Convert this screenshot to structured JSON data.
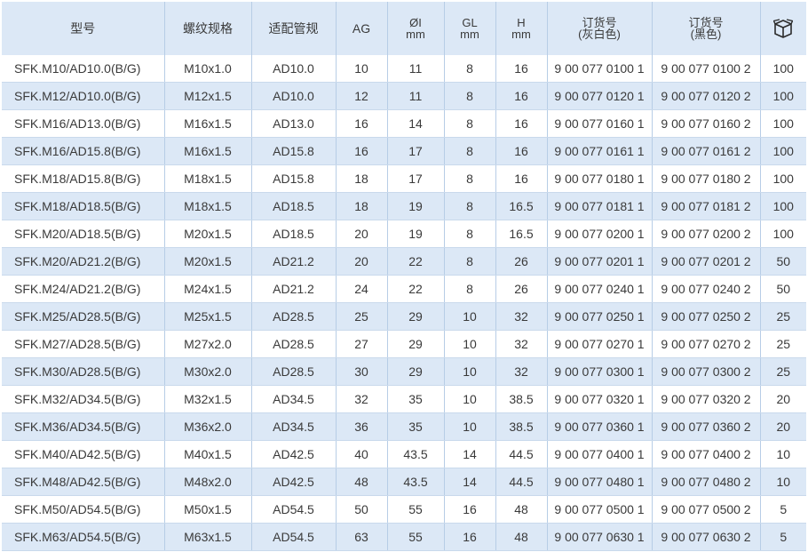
{
  "table": {
    "headers": {
      "model": "型号",
      "thread": "螺纹规格",
      "conduit": "适配管规",
      "ag": "AG",
      "id_top": "ØI",
      "id_unit": "mm",
      "gl_top": "GL",
      "gl_unit": "mm",
      "h_top": "H",
      "h_unit": "mm",
      "order_grey_top": "订货号",
      "order_grey_sub": "(灰白色)",
      "order_black_top": "订货号",
      "order_black_sub": "(黑色)",
      "package_icon": "box-icon"
    },
    "rows": [
      [
        "SFK.M10/AD10.0(B/G)",
        "M10x1.0",
        "AD10.0",
        "10",
        "11",
        "8",
        "16",
        "9 00 077 0100 1",
        "9 00 077 0100 2",
        "100"
      ],
      [
        "SFK.M12/AD10.0(B/G)",
        "M12x1.5",
        "AD10.0",
        "12",
        "11",
        "8",
        "16",
        "9 00 077 0120 1",
        "9 00 077 0120 2",
        "100"
      ],
      [
        "SFK.M16/AD13.0(B/G)",
        "M16x1.5",
        "AD13.0",
        "16",
        "14",
        "8",
        "16",
        "9 00 077 0160 1",
        "9 00 077 0160 2",
        "100"
      ],
      [
        "SFK.M16/AD15.8(B/G)",
        "M16x1.5",
        "AD15.8",
        "16",
        "17",
        "8",
        "16",
        "9 00 077 0161 1",
        "9 00 077 0161 2",
        "100"
      ],
      [
        "SFK.M18/AD15.8(B/G)",
        "M18x1.5",
        "AD15.8",
        "18",
        "17",
        "8",
        "16",
        "9 00 077 0180 1",
        "9 00 077 0180 2",
        "100"
      ],
      [
        "SFK.M18/AD18.5(B/G)",
        "M18x1.5",
        "AD18.5",
        "18",
        "19",
        "8",
        "16.5",
        "9 00 077 0181 1",
        "9 00 077 0181 2",
        "100"
      ],
      [
        "SFK.M20/AD18.5(B/G)",
        "M20x1.5",
        "AD18.5",
        "20",
        "19",
        "8",
        "16.5",
        "9 00 077 0200 1",
        "9 00 077 0200 2",
        "100"
      ],
      [
        "SFK.M20/AD21.2(B/G)",
        "M20x1.5",
        "AD21.2",
        "20",
        "22",
        "8",
        "26",
        "9 00 077 0201 1",
        "9 00 077 0201 2",
        "50"
      ],
      [
        "SFK.M24/AD21.2(B/G)",
        "M24x1.5",
        "AD21.2",
        "24",
        "22",
        "8",
        "26",
        "9 00 077 0240 1",
        "9 00 077 0240 2",
        "50"
      ],
      [
        "SFK.M25/AD28.5(B/G)",
        "M25x1.5",
        "AD28.5",
        "25",
        "29",
        "10",
        "32",
        "9 00 077 0250 1",
        "9 00 077 0250 2",
        "25"
      ],
      [
        "SFK.M27/AD28.5(B/G)",
        "M27x2.0",
        "AD28.5",
        "27",
        "29",
        "10",
        "32",
        "9 00 077 0270 1",
        "9 00 077 0270 2",
        "25"
      ],
      [
        "SFK.M30/AD28.5(B/G)",
        "M30x2.0",
        "AD28.5",
        "30",
        "29",
        "10",
        "32",
        "9 00 077 0300 1",
        "9 00 077 0300 2",
        "25"
      ],
      [
        "SFK.M32/AD34.5(B/G)",
        "M32x1.5",
        "AD34.5",
        "32",
        "35",
        "10",
        "38.5",
        "9 00 077 0320 1",
        "9 00 077 0320 2",
        "20"
      ],
      [
        "SFK.M36/AD34.5(B/G)",
        "M36x2.0",
        "AD34.5",
        "36",
        "35",
        "10",
        "38.5",
        "9 00 077 0360 1",
        "9 00 077 0360 2",
        "20"
      ],
      [
        "SFK.M40/AD42.5(B/G)",
        "M40x1.5",
        "AD42.5",
        "40",
        "43.5",
        "14",
        "44.5",
        "9 00 077 0400 1",
        "9 00 077 0400 2",
        "10"
      ],
      [
        "SFK.M48/AD42.5(B/G)",
        "M48x2.0",
        "AD42.5",
        "48",
        "43.5",
        "14",
        "44.5",
        "9 00 077 0480 1",
        "9 00 077 0480 2",
        "10"
      ],
      [
        "SFK.M50/AD54.5(B/G)",
        "M50x1.5",
        "AD54.5",
        "50",
        "55",
        "16",
        "48",
        "9 00 077 0500 1",
        "9 00 077 0500 2",
        "5"
      ],
      [
        "SFK.M63/AD54.5(B/G)",
        "M63x1.5",
        "AD54.5",
        "63",
        "55",
        "16",
        "48",
        "9 00 077 0630 1",
        "9 00 077 0630 2",
        "5"
      ]
    ]
  },
  "colors": {
    "header_bg": "#dce8f6",
    "stripe_bg": "#dce8f6",
    "text": "#3a3a3a"
  }
}
